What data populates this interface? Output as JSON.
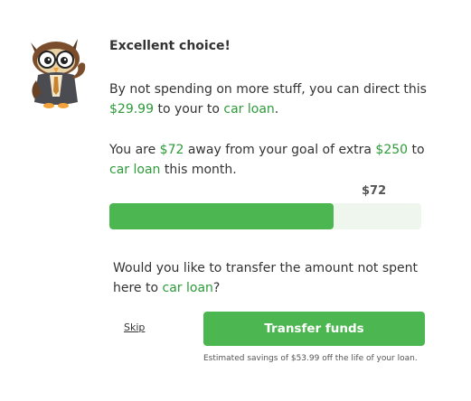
{
  "header": {
    "title": "Excellent choice!"
  },
  "message": {
    "p1_before": "By not spending on more stuff, you can direct this ",
    "amount": "$29.99",
    "p1_middle": " to your to ",
    "target": "car loan",
    "p1_end": "."
  },
  "goal": {
    "p2_before": "You are ",
    "remaining": "$72",
    "p2_middle": " away from your goal of extra ",
    "goal_amount": "$250",
    "p2_to": " to ",
    "target": "car loan",
    "p2_end": " this month."
  },
  "progress": {
    "label": "$72",
    "fraction": 0.72
  },
  "question": {
    "before": "Would you like to transfer the amount not spent here to ",
    "target": "car loan",
    "end": "?"
  },
  "actions": {
    "skip_label": "Skip",
    "transfer_label": "Transfer funds"
  },
  "footnote": "Estimated savings of $53.99 off the life of your loan.",
  "colors": {
    "accent": "#4cb650",
    "link": "#2e9a3a",
    "track": "#eef6ee"
  },
  "icons": {
    "mascot": "owl-mascot-icon"
  }
}
